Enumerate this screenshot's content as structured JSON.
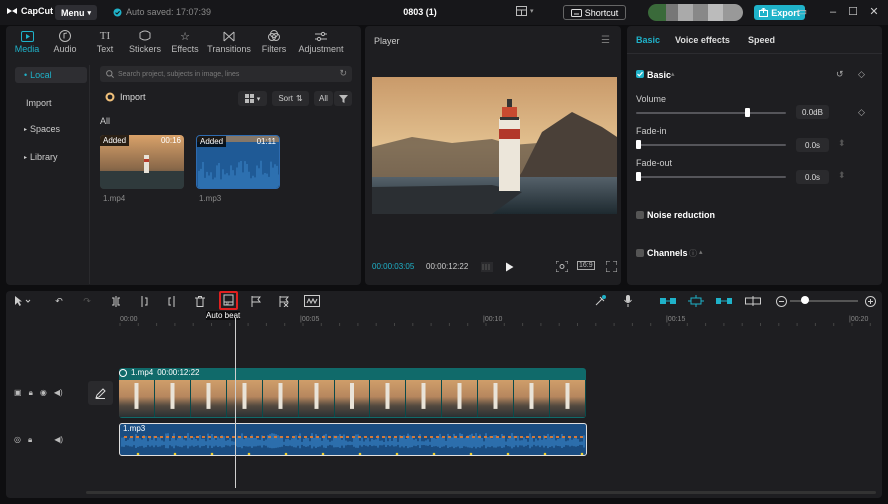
{
  "app": {
    "logo": "CapCut",
    "menu_label": "Menu",
    "autosave": "Auto saved: 17:07:39",
    "project_name": "0803 (1)",
    "shortcut_label": "Shortcut",
    "export_label": "Export"
  },
  "media": {
    "tabs": [
      {
        "label": "Media",
        "icon": "media-icon"
      },
      {
        "label": "Audio",
        "icon": "audio-icon"
      },
      {
        "label": "Text",
        "icon": "text-icon"
      },
      {
        "label": "Stickers",
        "icon": "stickers-icon"
      },
      {
        "label": "Effects",
        "icon": "effects-icon"
      },
      {
        "label": "Transitions",
        "icon": "transitions-icon"
      },
      {
        "label": "Filters",
        "icon": "filters-icon"
      },
      {
        "label": "Adjustment",
        "icon": "adjustment-icon"
      }
    ],
    "sidebar": [
      "Local",
      "Import",
      "Spaces",
      "Library"
    ],
    "search_placeholder": "Search project, subjects in image, lines",
    "import_label": "Import",
    "sort_label": "Sort",
    "all_filter": "All",
    "section_label": "All",
    "items": [
      {
        "name": "1.mp4",
        "badge": "Added",
        "duration": "00:16"
      },
      {
        "name": "1.mp3",
        "badge": "Added",
        "duration": "01:11"
      }
    ]
  },
  "player": {
    "title": "Player",
    "current_time": "00:00:03:05",
    "total_time": "00:00:12:22",
    "ratio_label": "16:9"
  },
  "properties": {
    "tabs": [
      "Basic",
      "Voice effects",
      "Speed"
    ],
    "basic_label": "Basic",
    "volume_label": "Volume",
    "volume_value": "0.0dB",
    "volume_level": 0.75,
    "fadein_label": "Fade-in",
    "fadein_value": "0.0s",
    "fadein_level": 0,
    "fadeout_label": "Fade-out",
    "fadeout_value": "0.0s",
    "fadeout_level": 0,
    "noise_label": "Noise reduction",
    "channels_label": "Channels"
  },
  "timeline": {
    "tooltip": "Auto beat",
    "ruler_ticks": [
      "00:00",
      "|00:05",
      "|00:10",
      "|00:15",
      "|00:20"
    ],
    "video_clip": {
      "name": "1.mp4",
      "duration": "00:00:12:22"
    },
    "audio_clip": {
      "name": "1.mp3"
    }
  },
  "colors": {
    "accent": "#1fb2c9",
    "highlight": "#e02020",
    "video_clip": "#106a6a",
    "audio_clip": "#1a4d82"
  }
}
